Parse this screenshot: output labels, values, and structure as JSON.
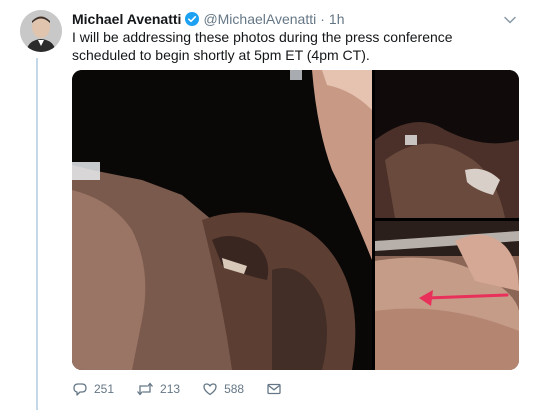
{
  "tweet": {
    "author": {
      "name": "Michael Avenatti",
      "handle": "@MichaelAvenatti",
      "verified": true
    },
    "separator": "·",
    "timestamp": "1h",
    "text": "I will be addressing these photos during the press conference scheduled to begin shortly at 5pm ET (4pm CT).",
    "media": {
      "photo_count": 3,
      "annotation": "red-arrow"
    },
    "actions": {
      "reply_count": "251",
      "retweet_count": "213",
      "like_count": "588"
    }
  },
  "icons": {
    "verified": "verified-badge-icon",
    "menu": "chevron-down-icon",
    "reply": "reply-icon",
    "retweet": "retweet-icon",
    "like": "heart-icon",
    "message": "envelope-icon"
  },
  "colors": {
    "verified_badge": "#1da1f2",
    "thread_line": "#c4d8e7",
    "secondary_text": "#657786",
    "annotation_arrow": "#e8305a"
  }
}
